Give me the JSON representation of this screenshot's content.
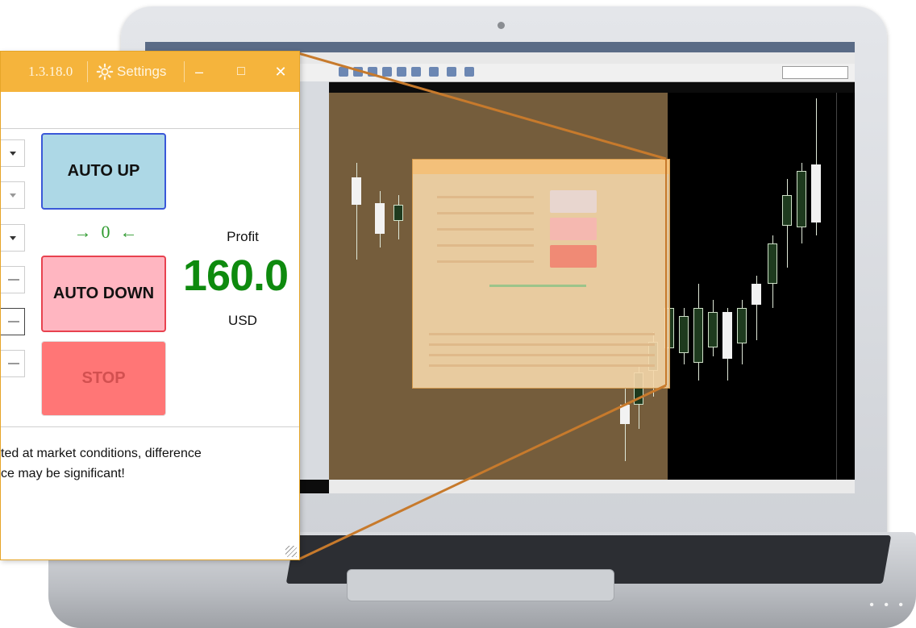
{
  "app": {
    "version": "1.3.18.0",
    "settings_label": "Settings",
    "minimize_glyph": "–",
    "maximize_glyph": "□",
    "close_glyph": "✕"
  },
  "controls": {
    "fields": [
      {
        "type": "dropdown"
      },
      {
        "type": "dropdown-disabled"
      },
      {
        "type": "dropdown"
      },
      {
        "type": "stepper"
      },
      {
        "type": "stepper"
      },
      {
        "type": "stepper"
      }
    ],
    "auto_up_label": "AUTO UP",
    "auto_down_label": "AUTO DOWN",
    "stop_label": "STOP",
    "counter": {
      "left_arrow": "→",
      "value": "0",
      "right_arrow": "←"
    }
  },
  "profit": {
    "label": "Profit",
    "value": "160.0",
    "currency": "USD"
  },
  "warning": {
    "line1": "ted at market conditions, difference",
    "line2": "ce may be significant!"
  },
  "colors": {
    "titlebar": "#f5b43c",
    "auto_up": "#add8e6",
    "auto_down": "#ffb6c1",
    "stop": "#ff7676",
    "profit": "#0e8a0e",
    "counter": "#2e9a2e"
  },
  "icons": {
    "settings": "gear-icon",
    "minimize": "minimize-icon",
    "maximize": "maximize-icon",
    "close": "close-icon"
  }
}
